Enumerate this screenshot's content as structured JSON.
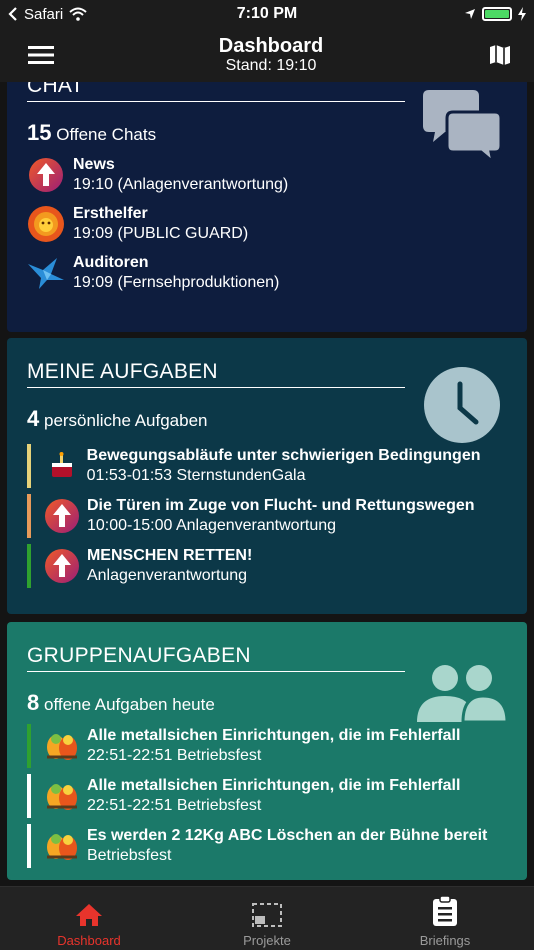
{
  "statusbar": {
    "carrier": "Safari",
    "time": "7:10 PM"
  },
  "header": {
    "title": "Dashboard",
    "subtitle": "Stand: 19:10"
  },
  "chat": {
    "heading": "CHAT",
    "count": "15",
    "count_label": "Offene Chats",
    "items": [
      {
        "title": "News",
        "subtitle": "19:10 (Anlagenverantwortung)",
        "icon": "arrow-up-avatar-icon"
      },
      {
        "title": "Ersthelfer",
        "subtitle": "19:09 (PUBLIC GUARD)",
        "icon": "lion-avatar-icon"
      },
      {
        "title": "Auditoren",
        "subtitle": "19:09 (Fernsehproduktionen)",
        "icon": "bird-avatar-icon"
      }
    ]
  },
  "tasks": {
    "heading": "MEINE AUFGABEN",
    "count": "4",
    "count_label": "persönliche Aufgaben",
    "items": [
      {
        "title": "Bewegungsabläufe unter schwierigen Bedingungen",
        "subtitle": "01:53-01:53 SternstundenGala",
        "bar_color": "#e6d27a",
        "icon": "cake-avatar-icon"
      },
      {
        "title": "Die Türen im Zuge von Flucht- und Rettungswegen",
        "subtitle": "10:00-15:00 Anlagenverantwortung",
        "bar_color": "#e89a5a",
        "icon": "arrow-up-avatar-icon"
      },
      {
        "title": "MENSCHEN RETTEN!",
        "subtitle": "Anlagenverantwortung",
        "bar_color": "#2fa12f",
        "icon": "arrow-up-avatar-icon"
      }
    ]
  },
  "group": {
    "heading": "GRUPPENAUFGABEN",
    "count": "8",
    "count_label": "offene Aufgaben heute",
    "items": [
      {
        "title": "Alle metallsichen Einrichtungen, die im Fehlerfall",
        "subtitle": "22:51-22:51 Betriebsfest",
        "bar_color": "#2fa12f",
        "icon": "parrots-avatar-icon"
      },
      {
        "title": "Alle metallsichen Einrichtungen, die im Fehlerfall",
        "subtitle": "22:51-22:51 Betriebsfest",
        "bar_color": "#ffffff",
        "icon": "parrots-avatar-icon"
      },
      {
        "title": "Es werden 2 12Kg ABC Löschen an der Bühne bereit",
        "subtitle": "Betriebsfest",
        "bar_color": "#ffffff",
        "icon": "parrots-avatar-icon"
      }
    ]
  },
  "tabs": [
    {
      "label": "Dashboard",
      "icon": "home-icon",
      "active": true,
      "color": "#e8342c"
    },
    {
      "label": "Projekte",
      "icon": "projects-icon",
      "active": false,
      "color": "#9a9a9a"
    },
    {
      "label": "Briefings",
      "icon": "clipboard-icon",
      "active": false,
      "color": "#9a9a9a"
    }
  ]
}
